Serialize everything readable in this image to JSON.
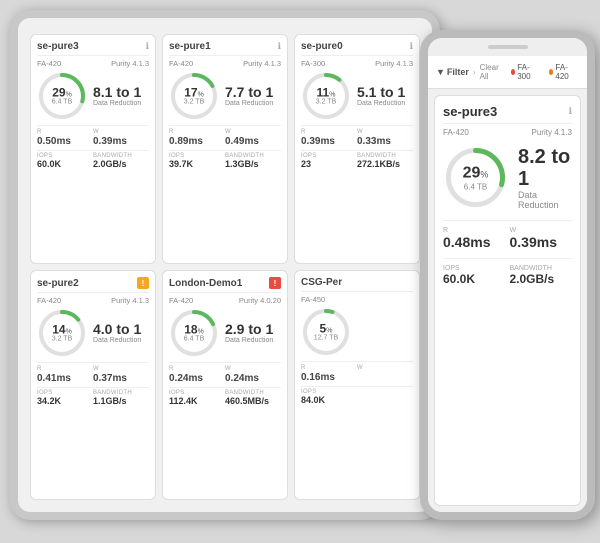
{
  "scene": {
    "bg": "#d8d8d8"
  },
  "tablet": {
    "cards": [
      {
        "id": "se-pure3",
        "title": "se-pure3",
        "model": "FA-420",
        "purity": "Purity 4.1.3",
        "badge": "info",
        "pct": 29,
        "tb": "6.4 TB",
        "ratio": "8.1 to 1",
        "ratioLabel": "Data Reduction",
        "rLabel": "R",
        "wLabel": "W",
        "rVal": "0.50ms",
        "wVal": "0.39ms",
        "iopsLabel": "IOPS",
        "bwLabel": "BANDWIDTH",
        "iops": "60.0K",
        "bw": "2.0GB/s",
        "gaugeColor": "#5cb85c",
        "gaugeTrack": "#e0e0e0"
      },
      {
        "id": "se-pure1",
        "title": "se-pure1",
        "model": "FA-420",
        "purity": "Purity 4.1.3",
        "badge": "info",
        "pct": 17,
        "tb": "3.2 TB",
        "ratio": "7.7 to 1",
        "ratioLabel": "Data Reduction",
        "rLabel": "R",
        "wLabel": "W",
        "rVal": "0.89ms",
        "wVal": "0.49ms",
        "iopsLabel": "IOPS",
        "bwLabel": "BANDWIDTH",
        "iops": "39.7K",
        "bw": "1.3GB/s",
        "gaugeColor": "#5cb85c",
        "gaugeTrack": "#e0e0e0"
      },
      {
        "id": "se-pure0",
        "title": "se-pure0",
        "model": "FA-300",
        "purity": "Purity 4.1.3",
        "badge": "info",
        "pct": 11,
        "tb": "3.2 TB",
        "ratio": "5.1 to 1",
        "ratioLabel": "Data Reduction",
        "rLabel": "R",
        "wLabel": "W",
        "rVal": "0.39ms",
        "wVal": "0.33ms",
        "iopsLabel": "IOPS",
        "bwLabel": "BANDWIDTH",
        "iops": "23",
        "bw": "272.1KB/s",
        "gaugeColor": "#5cb85c",
        "gaugeTrack": "#e0e0e0"
      },
      {
        "id": "se-pure2",
        "title": "se-pure2",
        "model": "FA-420",
        "purity": "Purity 4.1.3",
        "badge": "warning",
        "pct": 14,
        "tb": "3.2 TB",
        "ratio": "4.0 to 1",
        "ratioLabel": "Data Reduction",
        "rLabel": "R",
        "wLabel": "W",
        "rVal": "0.41ms",
        "wVal": "0.37ms",
        "iopsLabel": "IOPS",
        "bwLabel": "BANDWIDTH",
        "iops": "34.2K",
        "bw": "1.1GB/s",
        "gaugeColor": "#5cb85c",
        "gaugeTrack": "#e0e0e0"
      },
      {
        "id": "london-demo1",
        "title": "London-Demo1",
        "model": "FA-420",
        "purity": "Purity 4.0.20",
        "badge": "error",
        "pct": 18,
        "tb": "6.4 TB",
        "ratio": "2.9 to 1",
        "ratioLabel": "Data Reduction",
        "rLabel": "R",
        "wLabel": "W",
        "rVal": "0.24ms",
        "wVal": "0.24ms",
        "iopsLabel": "IOPS",
        "bwLabel": "BANDWIDTH",
        "iops": "112.4K",
        "bw": "460.5MB/s",
        "gaugeColor": "#5cb85c",
        "gaugeTrack": "#e0e0e0"
      },
      {
        "id": "csg-per",
        "title": "CSG-Per",
        "model": "FA-450",
        "purity": "",
        "badge": "none",
        "pct": 5,
        "tb": "12.7 TB",
        "ratio": "",
        "ratioLabel": "",
        "rLabel": "R",
        "wLabel": "W",
        "rVal": "0.16ms",
        "wVal": "",
        "iopsLabel": "IOPS",
        "bwLabel": "",
        "iops": "84.0K",
        "bw": "",
        "gaugeColor": "#5cb85c",
        "gaugeTrack": "#e0e0e0"
      }
    ]
  },
  "phone": {
    "filterLabel": "Filter",
    "clearAll": "Clear All",
    "tag1": "FA-300",
    "tag1Color": "#e74c3c",
    "tag2": "FA-420",
    "tag2Color": "#e67e22",
    "card": {
      "title": "se-pure3",
      "model": "FA-420",
      "purity": "Purity 4.1.3",
      "pct": 29,
      "tb": "6.4 TB",
      "ratio": "8.2 to 1",
      "ratioLabel": "Data Reduction",
      "rLabel": "R",
      "wLabel": "W",
      "rVal": "0.48ms",
      "wVal": "0.39ms",
      "iopsLabel": "IOPS",
      "bwLabel": "BANDWIDTH",
      "iops": "60.0K",
      "bw": "2.0GB/s",
      "gaugeColor": "#5cb85c"
    }
  }
}
